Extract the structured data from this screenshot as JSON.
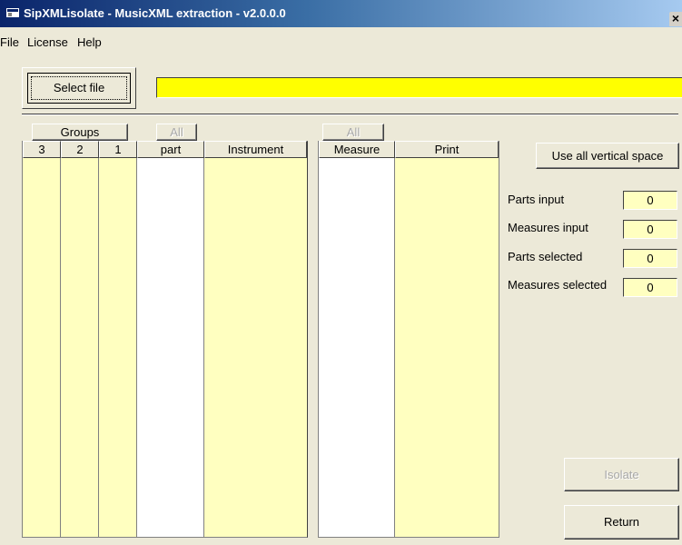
{
  "window": {
    "title": "SipXMLisolate - MusicXML extraction - v2.0.0.0",
    "close_label": "×"
  },
  "menu": [
    "File",
    "License",
    "Help"
  ],
  "select_file": {
    "label": "Select file",
    "path_value": ""
  },
  "groups": {
    "label": "Groups",
    "all_label": "All",
    "columns": [
      "3",
      "2",
      "1"
    ]
  },
  "parts_table": {
    "columns": [
      "part",
      "Instrument"
    ]
  },
  "measures": {
    "all_label": "All",
    "columns": [
      "Measure",
      "Print"
    ]
  },
  "use_all_space_label": "Use all vertical space",
  "stats": [
    {
      "label": "Parts input",
      "value": "0"
    },
    {
      "label": "Measures input",
      "value": "0"
    },
    {
      "label": "Parts selected",
      "value": "0"
    },
    {
      "label": "Measures selected",
      "value": "0"
    }
  ],
  "isolate_label": "Isolate",
  "return_label": "Return",
  "colors": {
    "field_bg": "#ffffc0",
    "path_bg": "#ffff00",
    "title_start": "#0a246a",
    "title_end": "#a6caf0"
  }
}
